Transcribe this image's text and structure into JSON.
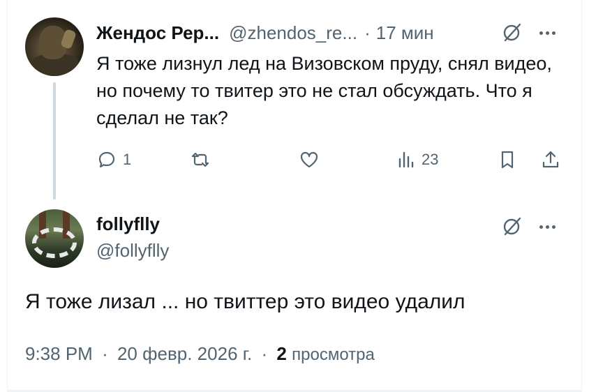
{
  "reply": {
    "author_name": "Жендос Реp...",
    "author_handle": "@zhendos_re...",
    "separator": "·",
    "time_ago": "17 мин",
    "text": "Я тоже лизнул лед на Визовском пруду, снял видео, но почему то твитер это не стал обсуждать. Что я сделал не так?",
    "actions": {
      "reply_count": "1",
      "retweet_count": "",
      "like_count": "",
      "views_count": "23"
    },
    "icons": [
      "grok-icon",
      "more-icon",
      "reply-icon",
      "retweet-icon",
      "like-icon",
      "views-icon",
      "bookmark-icon",
      "share-icon"
    ]
  },
  "tweet": {
    "author_name": "follyflly",
    "author_handle": "@follyflly",
    "text": "Я тоже лизал ... но твиттер это видео удалил",
    "time": "9:38 PM",
    "date": "20 февр. 2026 г.",
    "separator": "·",
    "views_count": "2",
    "views_label": "просмотра"
  },
  "colors": {
    "text_primary": "#0f1419",
    "text_secondary": "#536471",
    "thread_line": "#cfd9de",
    "background": "#ffffff"
  }
}
